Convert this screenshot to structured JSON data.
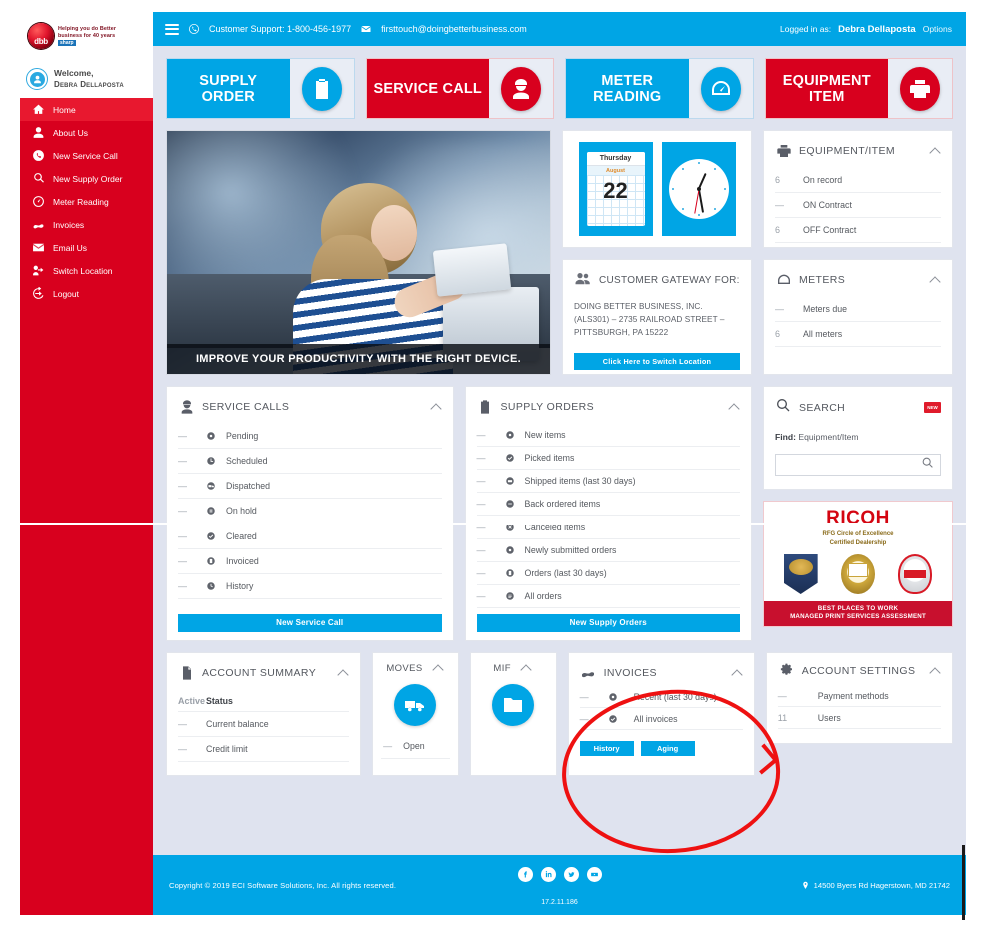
{
  "brand": {
    "logo_text": "dbb",
    "tagline_line1": "Helping you do Better",
    "tagline_line2": "business for 40 years",
    "tagline_line3": "sharp"
  },
  "sidebar": {
    "welcome_label": "Welcome,",
    "user_name": "Debra Dellaposta",
    "items": [
      {
        "label": "Home",
        "icon": "home-icon",
        "active": true
      },
      {
        "label": "About Us",
        "icon": "user-icon",
        "active": false
      },
      {
        "label": "New Service Call",
        "icon": "phone-icon",
        "active": false
      },
      {
        "label": "New Supply Order",
        "icon": "supply-icon",
        "active": false
      },
      {
        "label": "Meter Reading",
        "icon": "meter-icon",
        "active": false
      },
      {
        "label": "Invoices",
        "icon": "invoice-icon",
        "active": false
      },
      {
        "label": "Email Us",
        "icon": "mail-icon",
        "active": false
      },
      {
        "label": "Switch Location",
        "icon": "switch-icon",
        "active": false
      },
      {
        "label": "Logout",
        "icon": "logout-icon",
        "active": false
      }
    ]
  },
  "topbar": {
    "menu_icon": "hamburger-icon",
    "phone_icon": "phone-icon",
    "support_text": "Customer Support: 1-800-456-1977",
    "mail_icon": "mail-icon",
    "email_text": "firsttouch@doingbetterbusiness.com",
    "logged_in_label": "Logged in as:",
    "user_name": "Debra Dellaposta",
    "options_label": "Options"
  },
  "tiles": [
    {
      "label": "SUPPLY ORDER",
      "color": "blue",
      "icon": "clipboard-check-icon"
    },
    {
      "label": "SERVICE CALL",
      "color": "red",
      "icon": "technician-icon"
    },
    {
      "label": "METER READING",
      "color": "blue",
      "icon": "gauge-icon"
    },
    {
      "label": "EQUIPMENT ITEM",
      "color": "red",
      "icon": "printer-icon"
    }
  ],
  "hero": {
    "caption": "IMPROVE YOUR PRODUCTIVITY WITH THE RIGHT DEVICE."
  },
  "calendar": {
    "day_of_week": "Thursday",
    "month": "August",
    "day": "22"
  },
  "gateway": {
    "title": "CUSTOMER GATEWAY FOR:",
    "icon": "users-icon",
    "address": "DOING BETTER BUSINESS, INC. (ALS301) – 2735 RAILROAD STREET – PITTSBURGH, PA 15222",
    "button_label": "Click Here to Switch Location"
  },
  "equipment": {
    "title": "EQUIPMENT/ITEM",
    "icon": "printer-icon",
    "rows": [
      {
        "count": "6",
        "label": "On record"
      },
      {
        "count": "—",
        "label": "ON Contract"
      },
      {
        "count": "6",
        "label": "OFF Contract"
      }
    ]
  },
  "meters": {
    "title": "METERS",
    "icon": "gauge-icon",
    "rows": [
      {
        "count": "—",
        "label": "Meters due"
      },
      {
        "count": "6",
        "label": "All meters"
      }
    ]
  },
  "service_calls": {
    "title": "SERVICE CALLS",
    "icon": "technician-icon",
    "rows": [
      {
        "count": "—",
        "label": "Pending",
        "icon": "circle-dot-icon"
      },
      {
        "count": "—",
        "label": "Scheduled",
        "icon": "clock-icon"
      },
      {
        "count": "—",
        "label": "Dispatched",
        "icon": "truck-icon"
      },
      {
        "count": "—",
        "label": "On hold",
        "icon": "pause-icon"
      },
      {
        "count": "—",
        "label": "Cleared",
        "icon": "check-icon"
      },
      {
        "count": "—",
        "label": "Invoiced",
        "icon": "doc-icon"
      },
      {
        "count": "—",
        "label": "History",
        "icon": "history-icon"
      }
    ],
    "button_label": "New Service Call"
  },
  "supply_orders": {
    "title": "SUPPLY ORDERS",
    "icon": "clipboard-icon",
    "rows": [
      {
        "count": "—",
        "label": "New items",
        "icon": "circle-dot-icon"
      },
      {
        "count": "—",
        "label": "Picked items",
        "icon": "check-icon"
      },
      {
        "count": "—",
        "label": "Shipped items (last 30 days)",
        "icon": "box-icon"
      },
      {
        "count": "—",
        "label": "Back ordered items",
        "icon": "minus-icon"
      },
      {
        "count": "—",
        "label": "Canceled items",
        "icon": "x-icon"
      },
      {
        "count": "—",
        "label": "Newly submitted orders",
        "icon": "circle-dot-icon"
      },
      {
        "count": "—",
        "label": "Orders (last 30 days)",
        "icon": "doc-icon"
      },
      {
        "count": "—",
        "label": "All orders",
        "icon": "list-icon"
      }
    ],
    "button_label": "New Supply Orders"
  },
  "search": {
    "title": "SEARCH",
    "icon": "search-icon",
    "badge": "NEW",
    "find_label": "Find:",
    "find_value": "Equipment/Item",
    "input_value": "",
    "input_placeholder": ""
  },
  "ricoh": {
    "wordmark": "RICOH",
    "sub_line1": "RFG Circle of Excellence",
    "sub_line2": "Certified Dealership",
    "bar_line1": "BEST PLACES TO WORK",
    "bar_line2": "MANAGED PRINT SERVICES ASSESSMENT"
  },
  "account_summary": {
    "title": "ACCOUNT SUMMARY",
    "icon": "document-icon",
    "col_active": "Active",
    "col_status": "Status",
    "rows": [
      {
        "count": "—",
        "label": "Current balance"
      },
      {
        "count": "—",
        "label": "Credit limit"
      }
    ]
  },
  "moves": {
    "title": "MOVES",
    "icon": "moving-truck-icon",
    "rows": [
      {
        "count": "—",
        "label": "Open"
      }
    ]
  },
  "mif": {
    "title": "MIF",
    "icon": "folder-icon"
  },
  "invoices": {
    "title": "INVOICES",
    "icon": "invoice-icon",
    "rows": [
      {
        "count": "—",
        "label": "Recent (last 30 days)",
        "icon": "circle-dot-icon"
      },
      {
        "count": "—",
        "label": "All invoices",
        "icon": "check-icon"
      }
    ],
    "button_history": "History",
    "button_aging": "Aging"
  },
  "account_settings": {
    "title": "ACCOUNT SETTINGS",
    "icon": "gear-icon",
    "rows": [
      {
        "count": "—",
        "label": "Payment methods"
      },
      {
        "count": "11",
        "label": "Users"
      }
    ]
  },
  "footer": {
    "copyright": "Copyright © 2019 ECI Software Solutions, Inc. All rights reserved.",
    "version": "17.2.11.186",
    "address": "14500 Byers Rd Hagerstown, MD 21742",
    "social": [
      "facebook-icon",
      "linkedin-icon",
      "twitter-icon",
      "youtube-icon"
    ]
  },
  "colors": {
    "brand_red": "#d8001e",
    "brand_blue": "#00a5e5",
    "page_bg": "#dfe3ef",
    "annotation_red": "#ee1111"
  }
}
